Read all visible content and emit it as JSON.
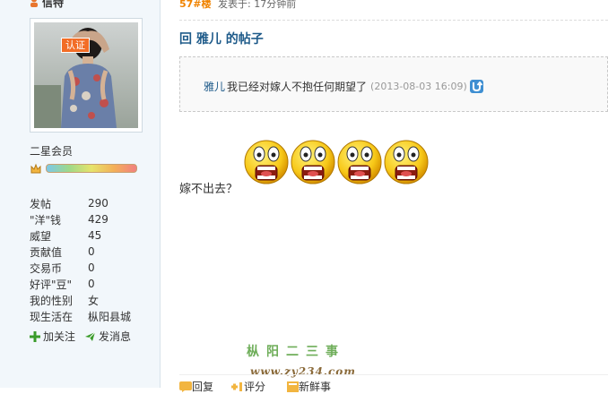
{
  "author": {
    "name": "信特",
    "verify_badge": "认证",
    "rank": "二星会员",
    "stats": [
      {
        "label": "发帖",
        "value": "290"
      },
      {
        "label": "\"洋\"钱",
        "value": "429"
      },
      {
        "label": "威望",
        "value": "45"
      },
      {
        "label": "贡献值",
        "value": "0"
      },
      {
        "label": "交易币",
        "value": "0"
      },
      {
        "label": "好评\"豆\"",
        "value": "0"
      },
      {
        "label": "我的性别",
        "value": "女"
      },
      {
        "label": "现生活在",
        "value": "枞阳县城"
      }
    ],
    "actions": {
      "follow": "加关注",
      "message": "发消息"
    }
  },
  "post": {
    "floor": "57#楼",
    "posted_prefix": "发表于:",
    "posted_time": "17分钟前",
    "reply_title": "回 雅儿 的帖子",
    "quote": {
      "author": "雅儿",
      "text": "我已经对嫁人不抱任何期望了",
      "date": "(2013-08-03 16:09)"
    },
    "body": "嫁不出去？",
    "smiley_count": 4
  },
  "footer": {
    "reply": "回复",
    "rate": "评分",
    "new": "新鲜事"
  },
  "watermark": {
    "text": "枞阳二三事",
    "url": "www.zy234.com"
  },
  "colors": {
    "link": "#1f5b8a",
    "floor": "#f08300",
    "sidebar_bg": "#f2f7fb",
    "watermark": "#6fae5a"
  }
}
